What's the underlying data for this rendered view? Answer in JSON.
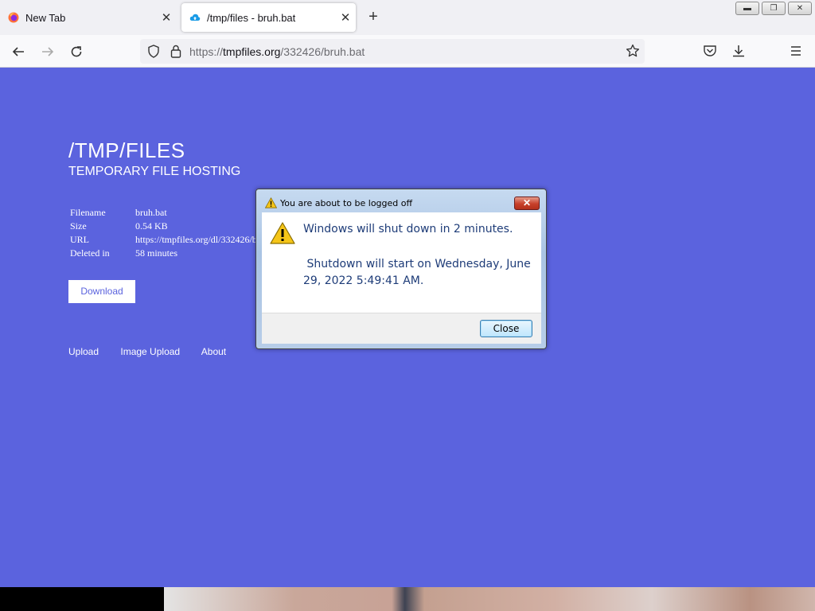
{
  "browser": {
    "tabs": [
      {
        "title": "New Tab",
        "active": false
      },
      {
        "title": "/tmp/files - bruh.bat",
        "active": true
      }
    ],
    "url": {
      "prefix": "https://",
      "host": "tmpfiles.org",
      "path": "/332426/bruh.bat"
    }
  },
  "page": {
    "title": "/TMP/FILES",
    "subtitle": "TEMPORARY FILE HOSTING",
    "file_info": [
      {
        "label": "Filename",
        "value": "bruh.bat"
      },
      {
        "label": "Size",
        "value": "0.54 KB"
      },
      {
        "label": "URL",
        "value": "https://tmpfiles.org/dl/332426/bruh.bat"
      },
      {
        "label": "Deleted in",
        "value": "58 minutes"
      }
    ],
    "download_label": "Download",
    "footer_links": [
      "Upload",
      "Image Upload",
      "About"
    ]
  },
  "dialog": {
    "title": "You are about to be logged off",
    "message1": "Windows will shut down in 2 minutes.",
    "message2": " Shutdown will start on Wednesday, June 29, 2022 5:49:41 AM.",
    "close_label": "Close"
  },
  "colors": {
    "page_background": "#5b63de",
    "dialog_text": "#1e3c78"
  }
}
